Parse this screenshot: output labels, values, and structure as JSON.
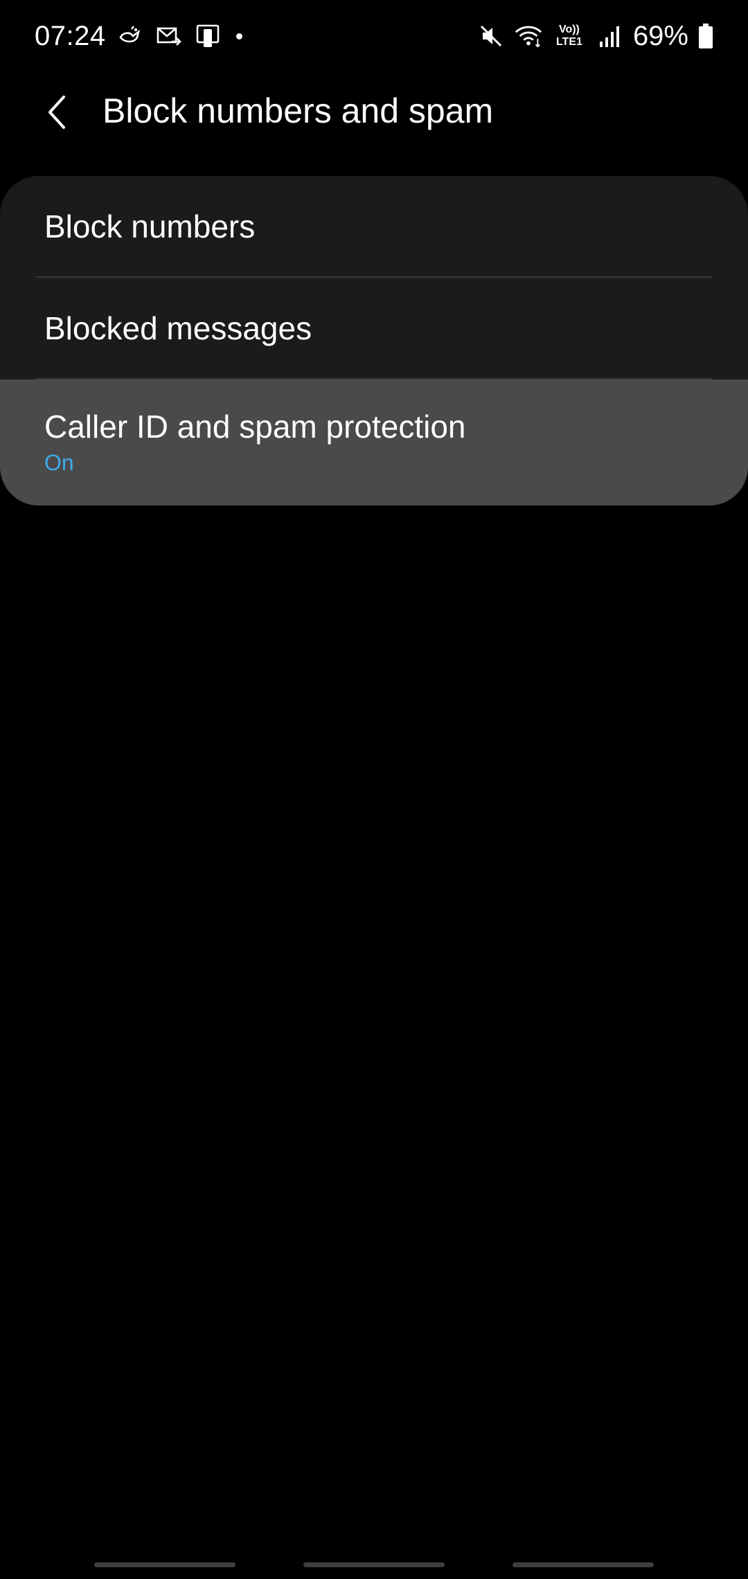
{
  "status_bar": {
    "time": "07:24",
    "battery_percent": "69%",
    "network_label": "Vo)) LTE1",
    "left_icons": [
      "bird-notification-icon",
      "mail-forward-icon",
      "phone-card-icon",
      "dot-icon"
    ],
    "right_icons": [
      "mute-icon",
      "wifi-icon",
      "volte-lte-icon",
      "signal-bars-icon",
      "battery-icon"
    ]
  },
  "header": {
    "title": "Block numbers and spam",
    "back_icon": "chevron-left-icon"
  },
  "settings": {
    "items": [
      {
        "label": "Block numbers"
      },
      {
        "label": "Blocked messages"
      },
      {
        "label": "Caller ID and spam protection",
        "sublabel": "On"
      }
    ]
  },
  "colors": {
    "background": "#000000",
    "card": "#1b1b1b",
    "highlight_row": "#4a4a4a",
    "accent": "#3fa9e8",
    "divider": "#3a3a3a"
  }
}
